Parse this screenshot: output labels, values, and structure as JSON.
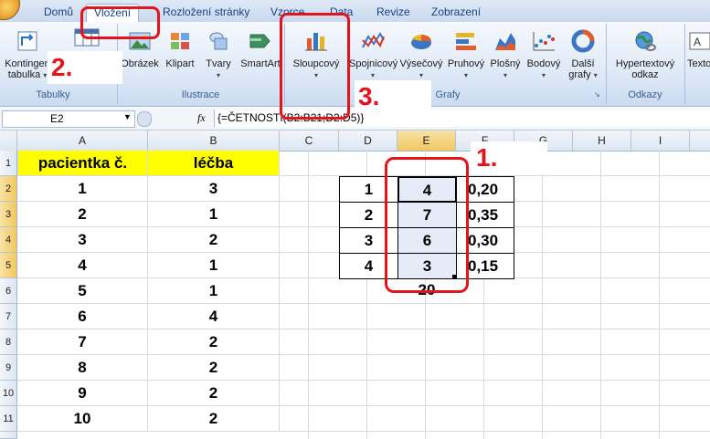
{
  "tabs": [
    "Domů",
    "Vložení",
    "Rozložení stránky",
    "Vzorce",
    "Data",
    "Revize",
    "Zobrazení"
  ],
  "active_tab": "Vložení",
  "groups": {
    "tabulky": "Tabulky",
    "ilustrace": "Ilustrace",
    "grafy": "Grafy",
    "odkazy": "Odkazy"
  },
  "buttons": {
    "kontingencni": "Kontingen tabulka",
    "obrazek": "Obrázek",
    "klipart": "Klipart",
    "tvary": "Tvary",
    "smartart": "SmartArt",
    "sloupcovy": "Sloupcový",
    "spojnicovy": "Spojnicový",
    "vysecovy": "Výsečový",
    "pruhovy": "Pruhový",
    "plosny": "Plošný",
    "bodovy": "Bodový",
    "dalsi": "Další grafy",
    "hypertext": "Hypertextový odkaz",
    "textove": "Texto"
  },
  "formula_bar": {
    "name_box": "E2",
    "fx": "fx",
    "formula": "{=ČETNOSTI(B2:B21;D2:D5)}"
  },
  "columns": [
    "A",
    "B",
    "C",
    "D",
    "E",
    "F",
    "G",
    "H",
    "I"
  ],
  "rows": [
    "1",
    "2",
    "3",
    "4",
    "5",
    "6",
    "7",
    "8",
    "9",
    "10",
    "11"
  ],
  "header_row": {
    "a": "pacientka č.",
    "b": "léčba"
  },
  "data_rows": [
    {
      "a": "1",
      "b": "3"
    },
    {
      "a": "2",
      "b": "1"
    },
    {
      "a": "3",
      "b": "2"
    },
    {
      "a": "4",
      "b": "1"
    },
    {
      "a": "5",
      "b": "1"
    },
    {
      "a": "6",
      "b": "4"
    },
    {
      "a": "7",
      "b": "2"
    },
    {
      "a": "8",
      "b": "2"
    },
    {
      "a": "9",
      "b": "2"
    },
    {
      "a": "10",
      "b": "2"
    }
  ],
  "freq_table": [
    {
      "d": "1",
      "e": "4",
      "f": "0,20"
    },
    {
      "d": "2",
      "e": "7",
      "f": "0,35"
    },
    {
      "d": "3",
      "e": "6",
      "f": "0,30"
    },
    {
      "d": "4",
      "e": "3",
      "f": "0,15"
    }
  ],
  "total": "20",
  "callouts": {
    "one": "1.",
    "two": "2.",
    "three": "3."
  },
  "colors": {
    "accent_red": "#e3141b",
    "header_yellow": "#ffff00",
    "selection": "#e6ecf7"
  }
}
